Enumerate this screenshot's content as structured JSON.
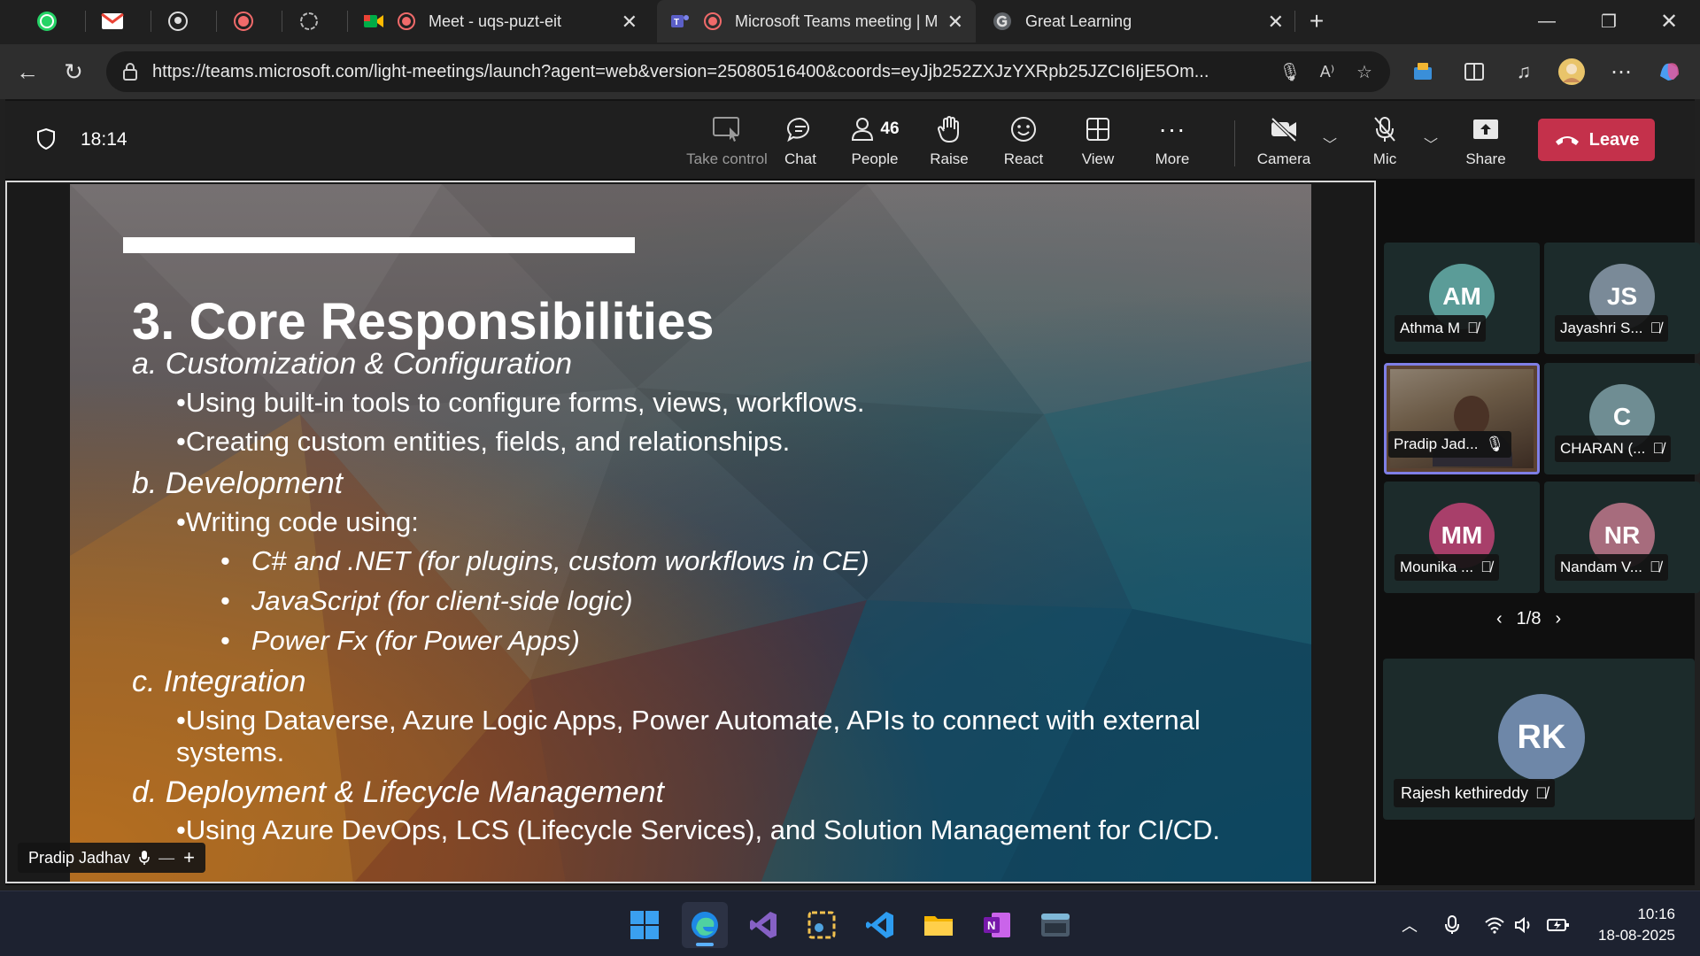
{
  "browser": {
    "pinned_tabs": [
      {
        "icon": "whatsapp-icon"
      },
      {
        "icon": "gmail-icon"
      },
      {
        "icon": "github-icon"
      },
      {
        "icon": "recording-icon"
      },
      {
        "icon": "chatgpt-icon"
      }
    ],
    "tabs": [
      {
        "title": "Meet - uqs-puzt-eit",
        "icon": "google-meet-icon"
      },
      {
        "title": "Microsoft Teams meeting | M",
        "icon": "teams-icon"
      },
      {
        "title": "Great Learning",
        "icon": "great-learning-icon"
      }
    ],
    "url": "https://teams.microsoft.com/light-meetings/launch?agent=web&version=25080516400&coords=eyJjb252ZXJzYXRpb25JZCI6IjE5Om..."
  },
  "meeting": {
    "timer": "18:14",
    "toolbar": [
      {
        "label": "Take control",
        "icon": "take-control-icon"
      },
      {
        "label": "Chat",
        "icon": "chat-icon"
      },
      {
        "label": "People",
        "icon": "people-icon",
        "count": "46"
      },
      {
        "label": "Raise",
        "icon": "raise-hand-icon"
      },
      {
        "label": "React",
        "icon": "react-icon"
      },
      {
        "label": "View",
        "icon": "view-icon"
      },
      {
        "label": "More",
        "icon": "more-icon"
      },
      {
        "label": "Camera",
        "icon": "camera-off-icon"
      },
      {
        "label": "Mic",
        "icon": "mic-off-icon"
      },
      {
        "label": "Share",
        "icon": "share-icon"
      }
    ],
    "leave_label": "Leave"
  },
  "slide": {
    "title": "3. Core Responsibilities",
    "sections": [
      {
        "heading": "a. Customization & Configuration",
        "bullets": [
          "•Using built-in tools to configure forms, views, workflows.",
          "•Creating custom entities, fields, and relationships."
        ]
      },
      {
        "heading": "b. Development",
        "bullets": [
          "•Writing code using:"
        ],
        "sub_bullets": [
          "C# and .NET (for plugins, custom workflows in CE)",
          "JavaScript (for client-side logic)",
          "Power Fx (for Power Apps)"
        ]
      },
      {
        "heading": "c. Integration",
        "bullets": [
          "•Using Dataverse, Azure Logic Apps, Power Automate, APIs to connect with external",
          "systems."
        ]
      },
      {
        "heading": "d. Deployment & Lifecycle Management",
        "bullets": [
          "•Using Azure DevOps, LCS (Lifecycle Services), and Solution Management for CI/CD."
        ]
      }
    ],
    "sub_bullet_dot": "•"
  },
  "presenter": {
    "name": "Pradip Jadhav"
  },
  "participants": [
    {
      "initials": "AM",
      "name": "Athma M",
      "color": "#5b9c98"
    },
    {
      "initials": "JS",
      "name": "Jayashri S...",
      "color": "#7a8a98"
    },
    {
      "initials": "",
      "name": "Pradip Jad...",
      "color": "#5b4232",
      "video": true
    },
    {
      "initials": "C",
      "name": "CHARAN (...",
      "color": "#6f8d93"
    },
    {
      "initials": "MM",
      "name": "Mounika ...",
      "color": "#a83f6a"
    },
    {
      "initials": "NR",
      "name": "Nandam V...",
      "color": "#a76c7d"
    }
  ],
  "pager": "1/8",
  "featured_participant": {
    "initials": "RK",
    "name": "Rajesh kethireddy"
  },
  "taskbar": {
    "apps": [
      "windows-start-icon",
      "edge-icon",
      "visual-studio-icon",
      "snipping-tool-icon",
      "vscode-icon",
      "file-explorer-icon",
      "onenote-icon",
      "terminal-icon"
    ],
    "time": "10:16",
    "date": "18-08-2025"
  }
}
